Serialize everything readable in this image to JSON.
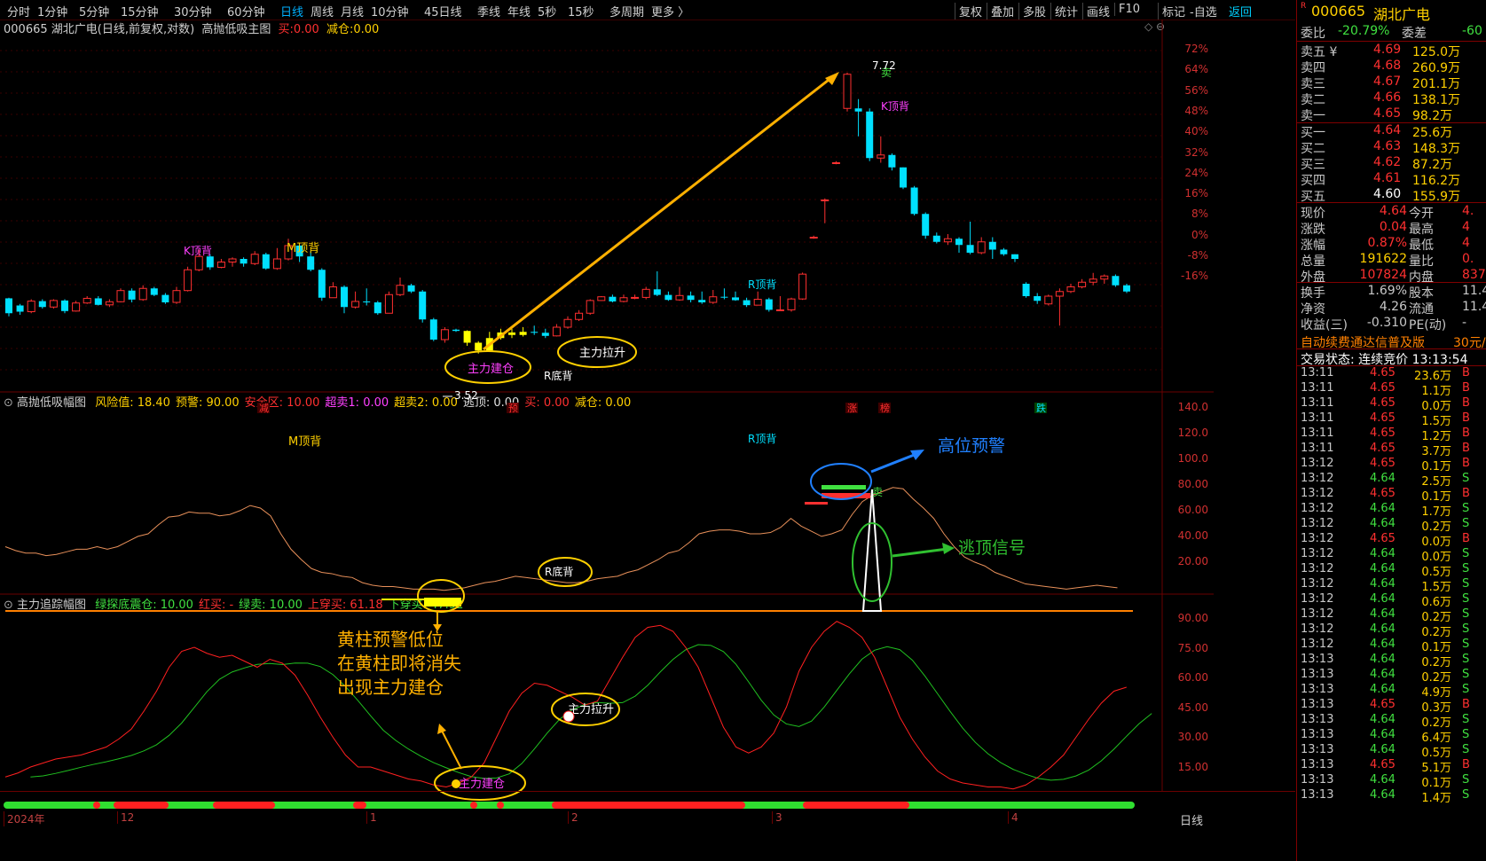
{
  "toolbar": {
    "periods": [
      "分时",
      "1分钟",
      "5分钟",
      "15分钟",
      "30分钟",
      "60分钟",
      "日线",
      "周线",
      "月线",
      "10分钟",
      "45日线",
      "季线",
      "年线",
      "5秒",
      "15秒",
      "多周期",
      "更多 〉"
    ],
    "active_period": "日线",
    "right_items": [
      "复权",
      "叠加",
      "多股",
      "统计",
      "画线",
      "F10",
      "标记"
    ],
    "watch_label": "-自选",
    "back_label": "返回"
  },
  "main_chart": {
    "title": "000665 湖北广电(日线,前复权,对数)",
    "indicator": "高抛低吸主图",
    "buy_label": "买:",
    "buy_value": "0.00",
    "reduce_label": "减仓:",
    "reduce_value": "0.00",
    "y_ticks": [
      "72%",
      "64%",
      "56%",
      "48%",
      "40%",
      "32%",
      "24%",
      "16%",
      "8%",
      "0%",
      "-8%",
      "-16%"
    ],
    "high_label": "7.72",
    "low_label": "3.52",
    "labels": {
      "k_top_1": "K顶背",
      "m_top": "M顶背",
      "r_top": "R顶背",
      "k_top_2": "K顶背",
      "r_bottom": "R底背",
      "sell": "卖",
      "build": "主力建仓",
      "pull": "主力拉升"
    },
    "bottom_marks": [
      "减",
      "预",
      "涨",
      "榜",
      "跌"
    ]
  },
  "sub1": {
    "title": "高抛低吸幅图",
    "params": [
      {
        "text": "风险值: 18.40",
        "color": "#ffd000"
      },
      {
        "text": "预警: 90.00",
        "color": "#ffd000"
      },
      {
        "text": "安全区: 10.00",
        "color": "#ff3030"
      },
      {
        "text": "超卖1: 0.00",
        "color": "#ff40ff"
      },
      {
        "text": "超卖2: 0.00",
        "color": "#ffd000"
      },
      {
        "text": "逃顶: 0.00",
        "color": "#e0e0e0"
      },
      {
        "text": "买: 0.00",
        "color": "#ff3030"
      },
      {
        "text": "减仓: 0.00",
        "color": "#ffd000"
      }
    ],
    "y_ticks": [
      "140.0",
      "120.0",
      "100.0",
      "80.00",
      "60.00",
      "40.00",
      "20.00"
    ],
    "labels": {
      "m_top": "M顶背",
      "r_top": "R顶背",
      "r_bottom": "R底背",
      "sell": "卖",
      "high_warn": "高位预警",
      "escape": "逃顶信号"
    }
  },
  "sub2": {
    "title": "主力追踪幅图",
    "params": [
      {
        "text": "绿探底震仓: 10.00",
        "color": "#40e040"
      },
      {
        "text": "红买: -",
        "color": "#ff3030"
      },
      {
        "text": "绿卖: 10.00",
        "color": "#40e040"
      },
      {
        "text": "上穿买: 61.18",
        "color": "#ff3030"
      },
      {
        "text": "下穿买: 47.92",
        "color": "#40e040"
      }
    ],
    "y_ticks": [
      "90.00",
      "75.00",
      "60.00",
      "45.00",
      "30.00",
      "15.00"
    ],
    "note_lines": [
      "黄柱预警低位",
      "在黄柱即将消失",
      "出现主力建仓"
    ],
    "labels": {
      "build": "主力建仓",
      "pull": "主力拉升"
    }
  },
  "x_axis": {
    "labels": [
      "2024年",
      "12",
      "1",
      "2",
      "3",
      "4"
    ],
    "period": "日线"
  },
  "quote": {
    "code": "000665",
    "name": "湖北广电",
    "weibi_label": "委比",
    "weibi": "-20.79%",
    "weicha_label": "委差",
    "weicha": "-60",
    "asks": [
      {
        "label": "卖五 ¥",
        "price": "4.69",
        "vol": "125.0万"
      },
      {
        "label": "卖四",
        "price": "4.68",
        "vol": "260.9万"
      },
      {
        "label": "卖三",
        "price": "4.67",
        "vol": "201.1万"
      },
      {
        "label": "卖二",
        "price": "4.66",
        "vol": "138.1万"
      },
      {
        "label": "卖一",
        "price": "4.65",
        "vol": "98.2万"
      }
    ],
    "bids": [
      {
        "label": "买一",
        "price": "4.64",
        "vol": "25.6万"
      },
      {
        "label": "买二",
        "price": "4.63",
        "vol": "148.3万"
      },
      {
        "label": "买三",
        "price": "4.62",
        "vol": "87.2万"
      },
      {
        "label": "买四",
        "price": "4.61",
        "vol": "116.2万"
      },
      {
        "label": "买五",
        "price": "4.60",
        "vol": "155.9万"
      }
    ],
    "stats": [
      {
        "l1": "现价",
        "v1": "4.64",
        "c1": "#ff3030",
        "l2": "今开",
        "v2": "4."
      },
      {
        "l1": "涨跌",
        "v1": "0.04",
        "c1": "#ff3030",
        "l2": "最高",
        "v2": "4"
      },
      {
        "l1": "涨幅",
        "v1": "0.87%",
        "c1": "#ff3030",
        "l2": "最低",
        "v2": "4"
      },
      {
        "l1": "总量",
        "v1": "191622",
        "c1": "#ffd000",
        "l2": "量比",
        "v2": "0."
      },
      {
        "l1": "外盘",
        "v1": "107824",
        "c1": "#ff3030",
        "l2": "内盘",
        "v2": "837"
      }
    ],
    "stats2": [
      {
        "l1": "换手",
        "v1": "1.69%",
        "l2": "股本",
        "v2": "11.4"
      },
      {
        "l1": "净资",
        "v1": "4.26",
        "l2": "流通",
        "v2": "11.4"
      },
      {
        "l1": "收益(三)",
        "v1": "-0.310",
        "l2": "PE(动)",
        "v2": "-"
      }
    ],
    "ad_text": "自动续费通达信普及版",
    "ad_price": "30元/",
    "trade_state": "交易状态: 连续竞价 13:13:54",
    "ticks": [
      {
        "t": "13:11",
        "p": "4.65",
        "v": "23.6万",
        "d": "B"
      },
      {
        "t": "13:11",
        "p": "4.65",
        "v": "1.1万",
        "d": "B"
      },
      {
        "t": "13:11",
        "p": "4.65",
        "v": "0.0万",
        "d": "B"
      },
      {
        "t": "13:11",
        "p": "4.65",
        "v": "1.5万",
        "d": "B"
      },
      {
        "t": "13:11",
        "p": "4.65",
        "v": "1.2万",
        "d": "B"
      },
      {
        "t": "13:11",
        "p": "4.65",
        "v": "3.7万",
        "d": "B"
      },
      {
        "t": "13:12",
        "p": "4.65",
        "v": "0.1万",
        "d": "B"
      },
      {
        "t": "13:12",
        "p": "4.64",
        "v": "2.5万",
        "d": "S"
      },
      {
        "t": "13:12",
        "p": "4.65",
        "v": "0.1万",
        "d": "B"
      },
      {
        "t": "13:12",
        "p": "4.64",
        "v": "1.7万",
        "d": "S"
      },
      {
        "t": "13:12",
        "p": "4.64",
        "v": "0.2万",
        "d": "S"
      },
      {
        "t": "13:12",
        "p": "4.65",
        "v": "0.0万",
        "d": "B"
      },
      {
        "t": "13:12",
        "p": "4.64",
        "v": "0.0万",
        "d": "S"
      },
      {
        "t": "13:12",
        "p": "4.64",
        "v": "0.5万",
        "d": "S"
      },
      {
        "t": "13:12",
        "p": "4.64",
        "v": "1.5万",
        "d": "S"
      },
      {
        "t": "13:12",
        "p": "4.64",
        "v": "0.6万",
        "d": "S"
      },
      {
        "t": "13:12",
        "p": "4.64",
        "v": "0.2万",
        "d": "S"
      },
      {
        "t": "13:12",
        "p": "4.64",
        "v": "0.2万",
        "d": "S"
      },
      {
        "t": "13:12",
        "p": "4.64",
        "v": "0.1万",
        "d": "S"
      },
      {
        "t": "13:13",
        "p": "4.64",
        "v": "0.2万",
        "d": "S"
      },
      {
        "t": "13:13",
        "p": "4.64",
        "v": "0.2万",
        "d": "S"
      },
      {
        "t": "13:13",
        "p": "4.64",
        "v": "4.9万",
        "d": "S"
      },
      {
        "t": "13:13",
        "p": "4.65",
        "v": "0.3万",
        "d": "B"
      },
      {
        "t": "13:13",
        "p": "4.64",
        "v": "0.2万",
        "d": "S"
      },
      {
        "t": "13:13",
        "p": "4.64",
        "v": "6.4万",
        "d": "S"
      },
      {
        "t": "13:13",
        "p": "4.64",
        "v": "0.5万",
        "d": "S"
      },
      {
        "t": "13:13",
        "p": "4.65",
        "v": "5.1万",
        "d": "B"
      },
      {
        "t": "13:13",
        "p": "4.64",
        "v": "0.1万",
        "d": "S"
      },
      {
        "t": "13:13",
        "p": "4.64",
        "v": "1.4万",
        "d": "S"
      }
    ]
  },
  "chart_data": {
    "type": "candlestick",
    "candles": [
      [
        0,
        1.3,
        -3.5,
        1.5,
        -4.5
      ],
      [
        1,
        -1.0,
        -3.0,
        -0.5,
        -4.0
      ],
      [
        2,
        -3.0,
        0.4,
        1.0,
        -3.5
      ],
      [
        3,
        0.4,
        -1.5,
        1.0,
        -2.0
      ],
      [
        4,
        -1.5,
        0.6,
        1.0,
        -2.0
      ],
      [
        5,
        0.6,
        -2.8,
        1.0,
        -3.5
      ],
      [
        6,
        -2.8,
        -0.2,
        0.5,
        -3.0
      ],
      [
        7,
        -0.2,
        1.3,
        2.0,
        -0.5
      ],
      [
        8,
        1.3,
        -0.8,
        2.0,
        -1.0
      ],
      [
        9,
        -0.8,
        0.2,
        1.0,
        -1.5
      ],
      [
        10,
        0.2,
        3.8,
        4.5,
        0
      ],
      [
        11,
        3.8,
        0.9,
        4.5,
        0
      ],
      [
        12,
        0.9,
        4.5,
        5.5,
        0.5
      ],
      [
        13,
        4.5,
        2.4,
        5.0,
        2.0
      ],
      [
        14,
        2.4,
        0,
        3.0,
        -0.5
      ],
      [
        15,
        0,
        3.8,
        5.0,
        -0.5
      ],
      [
        16,
        3.8,
        10.5,
        11.5,
        3.5
      ],
      [
        17,
        10.5,
        14.8,
        17.0,
        10.0
      ],
      [
        18,
        14.8,
        11.3,
        15.5,
        10.5
      ],
      [
        19,
        11.3,
        13.0,
        14.0,
        11.0
      ],
      [
        20,
        13.0,
        14.0,
        14.5,
        11.5
      ],
      [
        21,
        14.0,
        12.5,
        14.5,
        11.5
      ],
      [
        22,
        12.5,
        15.5,
        16.5,
        12.0
      ],
      [
        23,
        15.5,
        10.9,
        16.0,
        10.5
      ],
      [
        24,
        10.9,
        14.0,
        17.5,
        10.5
      ],
      [
        25,
        14.0,
        18.3,
        20.5,
        13.5
      ],
      [
        26,
        18.3,
        14.8,
        18.5,
        13.0
      ],
      [
        27,
        14.8,
        10.5,
        16.5,
        10.0
      ],
      [
        28,
        10.5,
        1.5,
        11.0,
        0.5
      ],
      [
        29,
        1.5,
        5.0,
        6.5,
        1.5
      ],
      [
        30,
        5.0,
        -1.5,
        5.5,
        -3.5
      ],
      [
        31,
        -1.5,
        0.3,
        3.5,
        -2.0
      ],
      [
        32,
        0.3,
        0,
        4.5,
        -1.0
      ],
      [
        33,
        0,
        -3.5,
        0.5,
        -4.0
      ],
      [
        34,
        -3.5,
        2.5,
        3.5,
        -2.0
      ],
      [
        35,
        2.5,
        5.5,
        8.0,
        2.0
      ],
      [
        36,
        5.5,
        3.5,
        6.0,
        3.0
      ],
      [
        37,
        3.5,
        -5.5,
        4.0,
        -6.5
      ],
      [
        38,
        -5.5,
        -12.0,
        -5.0,
        -12.5
      ],
      [
        39,
        -12.0,
        -8.8,
        -8.0,
        -13.0
      ],
      [
        40,
        -8.8,
        -9.2,
        -8.5,
        -9.5
      ],
      [
        41,
        -9.2,
        -13.0,
        -9.0,
        -14.0
      ],
      [
        42,
        -13.0,
        -15.5,
        -12.5,
        -16.5
      ],
      [
        43,
        -15.5,
        -11.5,
        -9.5,
        -16.0
      ],
      [
        44,
        -11.5,
        -9.7,
        -8.5,
        -12.0
      ],
      [
        45,
        -9.7,
        -10.5,
        -8.5,
        -11.5
      ],
      [
        46,
        -10.5,
        -9.5,
        -8.0,
        -11.0
      ],
      [
        47,
        -9.5,
        -9.8,
        -7.5,
        -10.5
      ],
      [
        48,
        -9.8,
        -10.8,
        -8.5,
        -11.5
      ],
      [
        49,
        -10.8,
        -8.0,
        -7.0,
        -11.0
      ],
      [
        50,
        -8.0,
        -5.5,
        -4.5,
        -8.5
      ],
      [
        51,
        -5.5,
        -3.5,
        -2.5,
        -6.0
      ],
      [
        52,
        -3.5,
        0.6,
        1.0,
        -4.0
      ],
      [
        53,
        0.6,
        1.8,
        2.0,
        0.5
      ],
      [
        54,
        1.8,
        0.3,
        2.5,
        0
      ],
      [
        55,
        0.3,
        1.5,
        2.5,
        0
      ],
      [
        56,
        1.5,
        1.6,
        2.5,
        1.0
      ],
      [
        57,
        1.6,
        4.2,
        5.0,
        1.0
      ],
      [
        58,
        4.2,
        2.4,
        10.0,
        2.0
      ],
      [
        59,
        2.4,
        0.8,
        3.5,
        0.5
      ],
      [
        60,
        0.8,
        2.2,
        5.0,
        0.5
      ],
      [
        61,
        2.2,
        0.8,
        3.5,
        0
      ],
      [
        62,
        0.8,
        0,
        3.5,
        -0.5
      ],
      [
        63,
        0,
        1.8,
        4.0,
        -0.5
      ],
      [
        64,
        1.8,
        1.6,
        4.5,
        1.0
      ],
      [
        65,
        1.6,
        0.7,
        3.5,
        0.5
      ],
      [
        66,
        0.7,
        -0.9,
        1.5,
        -1.5
      ],
      [
        67,
        -0.9,
        1.0,
        3.5,
        -1.0
      ],
      [
        68,
        1.0,
        -2.4,
        1.5,
        -3.0
      ],
      [
        69,
        -2.4,
        -2.4,
        2.0,
        -2.5
      ],
      [
        70,
        -2.4,
        1.1,
        1.5,
        -3.0
      ],
      [
        71,
        1.1,
        9.1,
        9.6,
        0.8
      ],
      [
        72,
        21.0,
        21.0,
        21.5,
        20.5
      ],
      [
        73,
        33.0,
        33.0,
        33.5,
        25.5
      ],
      [
        74,
        45.0,
        45.0,
        45.5,
        44.5
      ],
      [
        75,
        62.5,
        73.5,
        74.0,
        61.5
      ],
      [
        76,
        62.5,
        61.5,
        65.5,
        53.5
      ],
      [
        77,
        61.5,
        46.5,
        62.5,
        45.5
      ],
      [
        78,
        46.5,
        47.5,
        53.5,
        45.0
      ],
      [
        79,
        47.5,
        43.5,
        48.0,
        42.5
      ],
      [
        80,
        43.5,
        37.0,
        43.5,
        36.5
      ],
      [
        81,
        37.0,
        28.5,
        37.5,
        28.0
      ],
      [
        82,
        28.5,
        21.5,
        29.0,
        20.5
      ],
      [
        83,
        21.5,
        19.5,
        22.5,
        19.0
      ],
      [
        84,
        19.5,
        20.5,
        22.0,
        18.5
      ],
      [
        85,
        20.5,
        18.5,
        21.0,
        16.0
      ],
      [
        86,
        18.5,
        16.0,
        26.0,
        15.5
      ],
      [
        87,
        16.0,
        19.5,
        21.0,
        15.5
      ],
      [
        88,
        19.5,
        17.0,
        21.0,
        14.0
      ],
      [
        89,
        17.0,
        15.5,
        17.5,
        15.0
      ],
      [
        90,
        15.5,
        14.0,
        15.5,
        13.0
      ],
      [
        91,
        6.0,
        2.0,
        6.5,
        1.5
      ],
      [
        92,
        2.0,
        0.5,
        3.0,
        -0.5
      ],
      [
        93,
        -0.5,
        2.0,
        2.5,
        -1.0
      ],
      [
        94,
        2.0,
        3.5,
        4.5,
        -7.5
      ],
      [
        95,
        3.5,
        5.0,
        6.0,
        3.0
      ],
      [
        96,
        5.0,
        6.5,
        7.5,
        4.5
      ],
      [
        97,
        6.5,
        7.5,
        9.5,
        5.5
      ],
      [
        98,
        7.5,
        8.5,
        9.0,
        6.0
      ],
      [
        99,
        8.5,
        5.5,
        9.0,
        5.0
      ],
      [
        100,
        5.5,
        3.5,
        6.0,
        3.0
      ]
    ],
    "sub1_line": [
      50,
      47,
      45,
      45,
      43,
      44,
      46,
      48,
      48,
      50,
      48,
      50,
      54,
      58,
      60,
      67,
      73,
      74,
      77,
      76,
      76,
      74,
      75,
      78,
      82,
      80,
      74,
      60,
      48,
      40,
      33,
      30,
      29,
      27,
      26,
      22,
      20,
      19,
      19,
      18,
      17,
      17,
      17,
      16,
      17,
      18,
      20,
      22,
      23,
      25,
      27,
      26,
      25,
      24,
      23,
      22,
      22,
      23,
      25,
      26,
      27,
      30,
      32,
      36,
      40,
      45,
      47,
      53,
      60,
      62,
      63,
      63,
      62,
      60,
      60,
      61,
      65,
      72,
      66,
      62,
      58,
      60,
      63,
      75,
      85,
      90,
      93,
      96,
      95,
      87,
      80,
      72,
      60,
      50,
      42,
      38,
      35,
      30,
      27,
      24,
      21,
      20,
      19,
      18,
      17,
      18,
      19,
      20,
      19,
      18
    ],
    "sub2_red": [
      15,
      17,
      20,
      22,
      24,
      25,
      26,
      28,
      30,
      34,
      39,
      48,
      58,
      70,
      78,
      80,
      77,
      75,
      76,
      73,
      70,
      74,
      72,
      66,
      56,
      45,
      35,
      26,
      20,
      20,
      18,
      16,
      14,
      13,
      11,
      10,
      12,
      15,
      22,
      35,
      48,
      57,
      62,
      61,
      58,
      55,
      51,
      53,
      64,
      75,
      85,
      90,
      91,
      88,
      80,
      70,
      55,
      40,
      30,
      27,
      30,
      37,
      50,
      68,
      80,
      88,
      93,
      90,
      85,
      75,
      60,
      45,
      34,
      25,
      18,
      14,
      12,
      11,
      10,
      10,
      9,
      11,
      15,
      20,
      26,
      35,
      44,
      52,
      58,
      60
    ]
  }
}
